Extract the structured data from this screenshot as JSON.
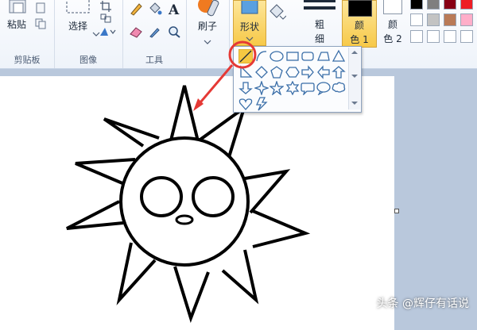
{
  "ribbon": {
    "clipboard": {
      "paste_label": "粘贴",
      "group_label": "剪贴板"
    },
    "image": {
      "select_label": "选择",
      "group_label": "图像"
    },
    "tools": {
      "group_label": "工具"
    },
    "brush": {
      "label": "刷子"
    },
    "shapes": {
      "label": "形状"
    },
    "size": {
      "label_top": "粗",
      "label_bottom": "细"
    },
    "color1": {
      "label_top": "颜",
      "label_bottom": "色 1"
    },
    "color2": {
      "label_top": "颜",
      "label_bottom": "色 2"
    },
    "palette": [
      "#000000",
      "#7f7f7f",
      "#880015",
      "#ed1c24",
      "#ffffff",
      "#c3c3c3",
      "#b97a57",
      "#ffaec9",
      "#ffffff",
      "#ffffff",
      "#ffffff",
      "#ffffff"
    ]
  },
  "shapes_popup": {
    "shapes": [
      "selected-diagonal",
      "curve",
      "oval",
      "rectangle",
      "rounded-rectangle",
      "polygon",
      "triangle",
      "right-triangle",
      "diamond",
      "pentagon",
      "hexagon",
      "right-arrow",
      "left-arrow",
      "up-arrow",
      "down-arrow",
      "four-point-star",
      "five-point-star",
      "six-point-star",
      "rounded-callout",
      "oval-callout",
      "cloud-callout",
      "heart",
      "lightning"
    ]
  },
  "colors": {
    "accent": "#f5c842",
    "highlight_circle": "#e53935",
    "arrow": "#e53935"
  },
  "watermark": "头条 @辉仔有话说"
}
